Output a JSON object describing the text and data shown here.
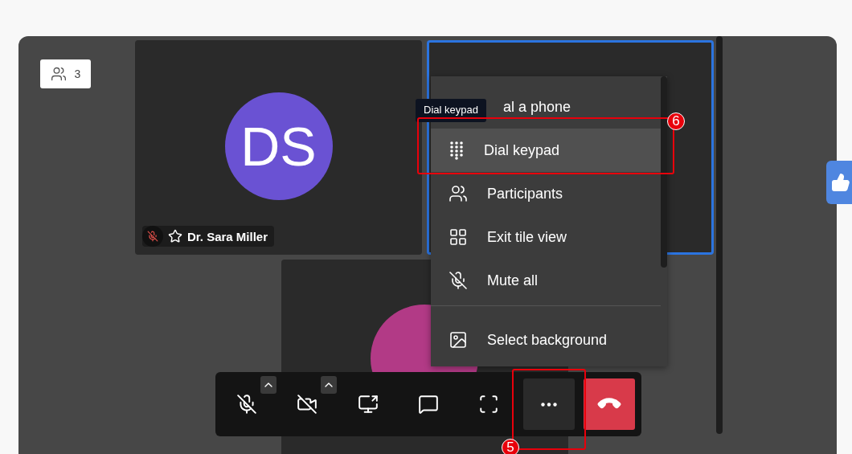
{
  "participants_badge": {
    "count": "3"
  },
  "tiles": [
    {
      "initials": "DS",
      "name": "Dr. Sara Miller",
      "color": "#6a52d3",
      "muted": true,
      "selected": false
    },
    {
      "selected": true
    },
    {
      "color": "#b23a86",
      "selected": false
    }
  ],
  "tooltip": "Dial keypad",
  "menu": [
    {
      "kind": "phone",
      "label": "al a phone",
      "selected": false
    },
    {
      "kind": "keypad",
      "label": "Dial keypad",
      "selected": true
    },
    {
      "kind": "participants",
      "label": "Participants",
      "selected": false
    },
    {
      "kind": "tiles",
      "label": "Exit tile view",
      "selected": false
    },
    {
      "kind": "mute",
      "label": "Mute all",
      "selected": false
    },
    {
      "kind": "divider"
    },
    {
      "kind": "background",
      "label": "Select background",
      "selected": false
    }
  ],
  "toolbar": [
    {
      "kind": "mic",
      "has_options": true,
      "selected": false
    },
    {
      "kind": "camera",
      "has_options": true,
      "selected": false
    },
    {
      "kind": "share",
      "has_options": false,
      "selected": false
    },
    {
      "kind": "chat",
      "has_options": false,
      "selected": false
    },
    {
      "kind": "fullscreen",
      "has_options": false,
      "selected": false
    },
    {
      "kind": "more",
      "has_options": false,
      "selected": true
    },
    {
      "kind": "hangup",
      "has_options": false
    }
  ],
  "annotations": [
    {
      "label": "6"
    },
    {
      "label": "5"
    }
  ]
}
